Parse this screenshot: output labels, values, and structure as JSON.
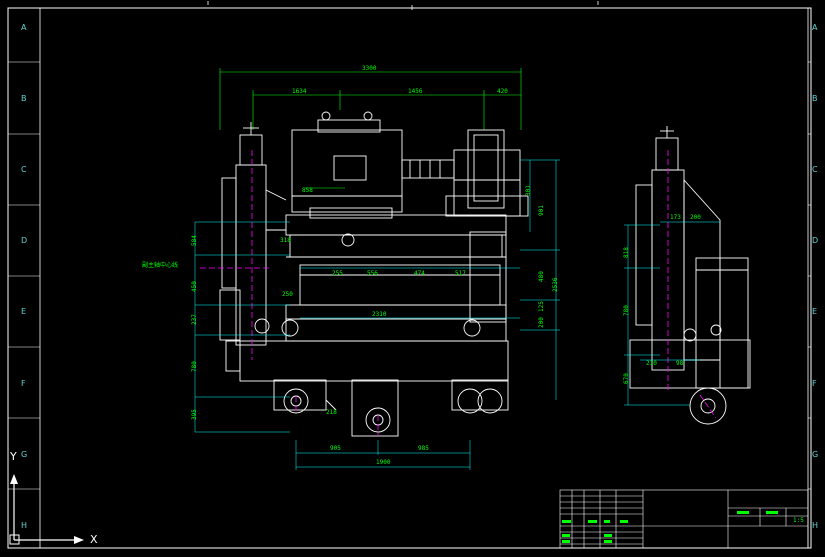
{
  "zones": [
    "A",
    "B",
    "C",
    "D",
    "E",
    "F",
    "G",
    "H"
  ],
  "ucs": {
    "x_label": "X",
    "y_label": "Y"
  },
  "left_note": "副主轴中心线",
  "dimensions": {
    "overall_width": "3300",
    "seg_1": "1634",
    "seg_2": "1456",
    "seg_3": "420",
    "motor_offset": "858",
    "h_255": "255",
    "h_556": "556",
    "h_474": "474",
    "h_517": "517",
    "shaft_2310": "2310",
    "wheel_905": "905",
    "wheel_985": "985",
    "wheel_1900": "1900",
    "left_584": "584",
    "left_450": "450",
    "left_237": "237",
    "left_780": "780",
    "left_395": "395",
    "r_301": "301",
    "r_901": "901",
    "r_480": "480",
    "r_2536": "2536",
    "r_125": "125",
    "r_200": "200",
    "small_318": "318",
    "small_250": "250",
    "small_218": "218",
    "side_173": "173",
    "side_200": "200",
    "side_818": "818",
    "side_780": "780",
    "side_670": "670",
    "side_210": "210",
    "side_98": "98"
  },
  "title_block": {
    "scale": "1:5"
  },
  "colors": {
    "background": "#000000",
    "frame": "#ffffff",
    "geometry": "#ffffff",
    "dimension": "#00ff00",
    "extension": "#00ffff",
    "centerline": "#ff00ff"
  }
}
